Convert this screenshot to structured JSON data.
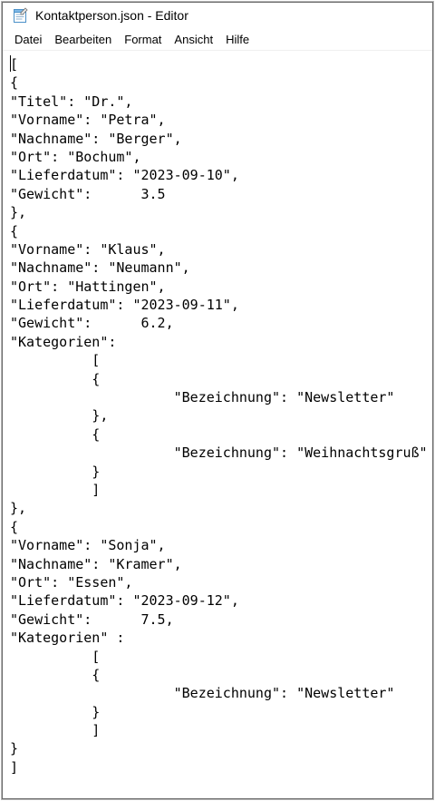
{
  "window": {
    "title": "Kontaktperson.json - Editor",
    "app_icon": "notepad-icon"
  },
  "menu": {
    "items": [
      "Datei",
      "Bearbeiten",
      "Format",
      "Ansicht",
      "Hilfe"
    ]
  },
  "editor": {
    "lines": [
      "[",
      "{",
      "\"Titel\": \"Dr.\",",
      "\"Vorname\": \"Petra\",",
      "\"Nachname\": \"Berger\",",
      "\"Ort\": \"Bochum\",",
      "\"Lieferdatum\": \"2023-09-10\",",
      "\"Gewicht\":      3.5",
      "},",
      "{",
      "\"Vorname\": \"Klaus\",",
      "\"Nachname\": \"Neumann\",",
      "\"Ort\": \"Hattingen\",",
      "\"Lieferdatum\": \"2023-09-11\",",
      "\"Gewicht\":      6.2,",
      "\"Kategorien\":",
      "          [",
      "          {",
      "                    \"Bezeichnung\": \"Newsletter\"",
      "          },",
      "          {",
      "                    \"Bezeichnung\": \"Weihnachtsgruß\"",
      "          }",
      "          ]",
      "},",
      "{",
      "\"Vorname\": \"Sonja\",",
      "\"Nachname\": \"Kramer\",",
      "\"Ort\": \"Essen\",",
      "\"Lieferdatum\": \"2023-09-12\",",
      "\"Gewicht\":      7.5,",
      "\"Kategorien\" :",
      "          [",
      "          {",
      "                    \"Bezeichnung\": \"Newsletter\"",
      "          }",
      "          ]",
      "}",
      "]"
    ]
  }
}
